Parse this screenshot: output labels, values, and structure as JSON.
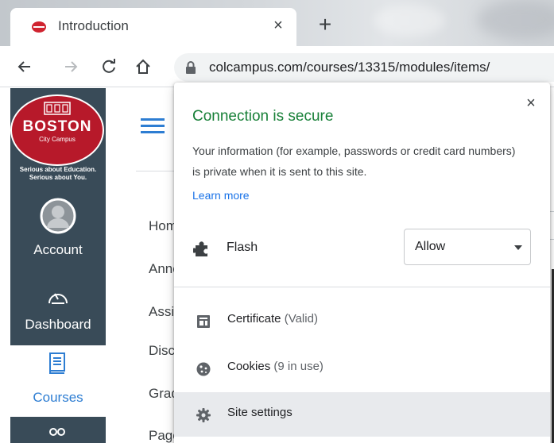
{
  "browser": {
    "tab_title": "Introduction",
    "tab_close": "×",
    "new_tab": "+",
    "url": "colcampus.com/courses/13315/modules/items/"
  },
  "leftnav": {
    "logo": {
      "name": "BOSTON",
      "sub": "City Campus",
      "tagline_1": "Serious about Education.",
      "tagline_2": "Serious about You."
    },
    "items": [
      {
        "label": "Account",
        "icon": "avatar-icon"
      },
      {
        "label": "Dashboard",
        "icon": "dashboard-gauge-icon"
      },
      {
        "label": "Courses",
        "icon": "book-icon",
        "active": true
      }
    ]
  },
  "course_menu": {
    "items": [
      "Home",
      "Announcements",
      "Assignments",
      "Discussions",
      "Grades",
      "Pages"
    ]
  },
  "popup": {
    "close": "×",
    "title": "Connection is secure",
    "description": "Your information (for example, passwords or credit card numbers) is private when it is sent to this site.",
    "learn_more": "Learn more",
    "flash": {
      "label": "Flash",
      "value": "Allow"
    },
    "rows": [
      {
        "label": "Certificate",
        "detail": "(Valid)",
        "icon": "certificate-icon"
      },
      {
        "label": "Cookies",
        "detail": "(9 in use)",
        "icon": "cookie-icon"
      },
      {
        "label": "Site settings",
        "detail": "",
        "icon": "gear-icon"
      }
    ]
  },
  "colors": {
    "secure_green": "#188038",
    "link_blue": "#1a73e8",
    "canvas_nav": "#394b58",
    "brand_red": "#b7192a",
    "canvas_blue": "#2d7dd2"
  }
}
